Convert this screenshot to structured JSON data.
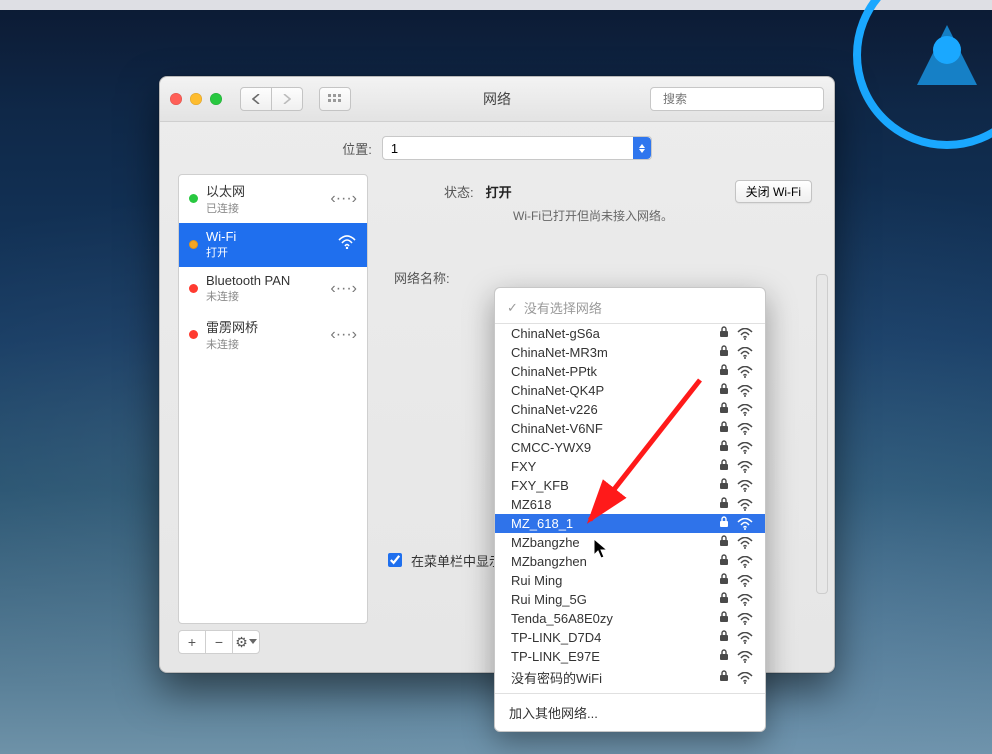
{
  "window": {
    "title": "网络",
    "search_placeholder": "搜索"
  },
  "location": {
    "label": "位置:",
    "value": "1"
  },
  "sidebar": {
    "items": [
      {
        "name": "以太网",
        "sub": "已连接",
        "status": "green",
        "icon": "dots"
      },
      {
        "name": "Wi-Fi",
        "sub": "打开",
        "status": "orange",
        "icon": "wifi",
        "selected": true
      },
      {
        "name": "Bluetooth PAN",
        "sub": "未连接",
        "status": "red",
        "icon": "dots"
      },
      {
        "name": "雷雳网桥",
        "sub": "未连接",
        "status": "red",
        "icon": "dots"
      }
    ],
    "controls": {
      "add": "+",
      "remove": "−",
      "gear": "⚙"
    }
  },
  "panel": {
    "status_label": "状态:",
    "status_value": "打开",
    "toggle_button": "关闭 Wi-Fi",
    "sub_status": "Wi-Fi已打开但尚未接入网络。",
    "network_name_label": "网络名称:",
    "menubar_checkbox_label": "在菜单栏中显示 W"
  },
  "dropdown": {
    "header": "没有选择网络",
    "selected_index": 10,
    "items": [
      {
        "ssid": "ChinaNet-gS6a",
        "locked": true,
        "signal": 3
      },
      {
        "ssid": "ChinaNet-MR3m",
        "locked": true,
        "signal": 3
      },
      {
        "ssid": "ChinaNet-PPtk",
        "locked": true,
        "signal": 3
      },
      {
        "ssid": "ChinaNet-QK4P",
        "locked": true,
        "signal": 3
      },
      {
        "ssid": "ChinaNet-v226",
        "locked": true,
        "signal": 3
      },
      {
        "ssid": "ChinaNet-V6NF",
        "locked": true,
        "signal": 3
      },
      {
        "ssid": "CMCC-YWX9",
        "locked": true,
        "signal": 3
      },
      {
        "ssid": "FXY",
        "locked": true,
        "signal": 3
      },
      {
        "ssid": "FXY_KFB",
        "locked": true,
        "signal": 3
      },
      {
        "ssid": "MZ618",
        "locked": true,
        "signal": 3
      },
      {
        "ssid": "MZ_618_1",
        "locked": true,
        "signal": 3
      },
      {
        "ssid": "MZbangzhe",
        "locked": true,
        "signal": 3
      },
      {
        "ssid": "MZbangzhen",
        "locked": true,
        "signal": 3
      },
      {
        "ssid": "Rui Ming",
        "locked": true,
        "signal": 3
      },
      {
        "ssid": "Rui Ming_5G",
        "locked": true,
        "signal": 3
      },
      {
        "ssid": "Tenda_56A8E0zy",
        "locked": true,
        "signal": 3
      },
      {
        "ssid": "TP-LINK_D7D4",
        "locked": true,
        "signal": 3
      },
      {
        "ssid": "TP-LINK_E97E",
        "locked": true,
        "signal": 3
      },
      {
        "ssid": "没有密码的WiFi",
        "locked": true,
        "signal": 3
      }
    ],
    "footer": "加入其他网络..."
  }
}
